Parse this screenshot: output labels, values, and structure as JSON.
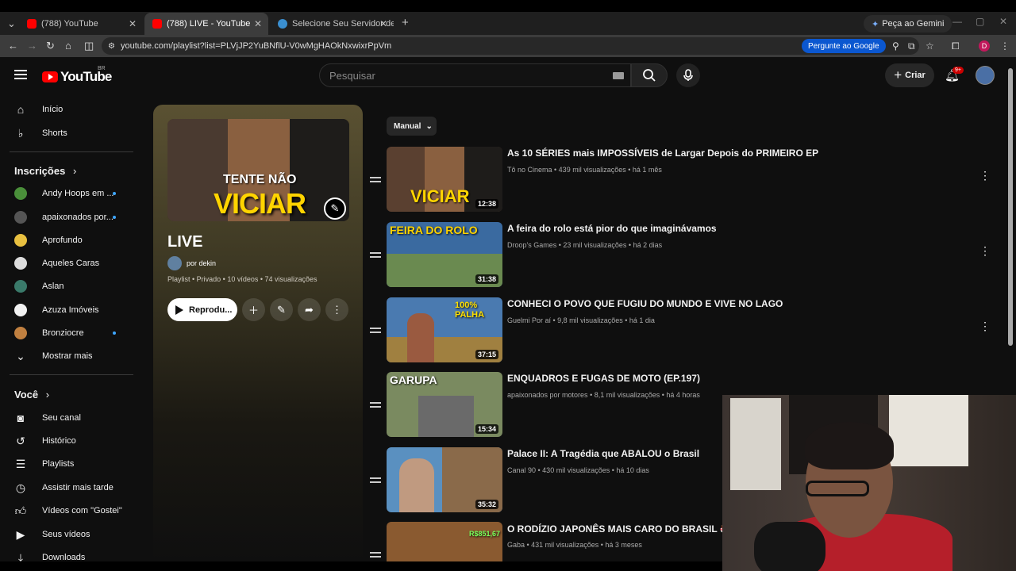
{
  "browser": {
    "tabs": [
      {
        "title": "(788) YouTube",
        "active": false
      },
      {
        "title": "(788) LIVE - YouTube",
        "active": true
      },
      {
        "title": "Selecione Seu Servidor de Jogo",
        "active": false
      }
    ],
    "gemini_label": "Peça ao Gemini",
    "url": "youtube.com/playlist?list=PLVjJP2YuBNflU-V0wMgHAOkNxwixrPpVm",
    "ask_google_label": "Pergunte ao Google",
    "profile_letter": "D"
  },
  "masthead": {
    "logo_text": "YouTube",
    "country": "BR",
    "search_placeholder": "Pesquisar",
    "create_label": "Criar",
    "notifications_badge": "9+"
  },
  "sidebar": {
    "main": [
      {
        "label": "Início",
        "icon": "home-icon"
      },
      {
        "label": "Shorts",
        "icon": "shorts-icon"
      }
    ],
    "subscriptions_heading": "Inscrições",
    "subscriptions": [
      {
        "label": "Andy Hoops em ...",
        "dot": true,
        "color": "#4a8f3a"
      },
      {
        "label": "apaixonados por...",
        "dot": true,
        "color": "#555555"
      },
      {
        "label": "Aprofundo",
        "dot": false,
        "color": "#e8c040"
      },
      {
        "label": "Aqueles Caras",
        "dot": false,
        "color": "#dddddd"
      },
      {
        "label": "Aslan",
        "dot": false,
        "color": "#3a7a6a"
      },
      {
        "label": "Azuza Imóveis",
        "dot": false,
        "color": "#f1f1f1"
      },
      {
        "label": "Bronziocre",
        "dot": true,
        "color": "#c08040"
      }
    ],
    "show_more_label": "Mostrar mais",
    "you_heading": "Você",
    "you_items": [
      {
        "label": "Seu canal",
        "icon": "channel-icon"
      },
      {
        "label": "Histórico",
        "icon": "history-icon"
      },
      {
        "label": "Playlists",
        "icon": "playlists-icon"
      },
      {
        "label": "Assistir mais tarde",
        "icon": "watch-later-icon"
      },
      {
        "label": "Vídeos com \"Gostei\"",
        "icon": "like-icon"
      },
      {
        "label": "Seus vídeos",
        "icon": "your-videos-icon"
      },
      {
        "label": "Downloads",
        "icon": "download-icon"
      }
    ]
  },
  "playlist": {
    "thumb_caption_top": "TENTE NÃO",
    "thumb_caption_big": "VICIAR",
    "title": "LIVE",
    "owner": "por dekin",
    "meta": "Playlist • Privado • 10 vídeos • 74 visualizações",
    "play_label": "Reprodu..."
  },
  "list": {
    "sort_label": "Manual",
    "videos": [
      {
        "title": "As 10 SÉRIES mais IMPOSSÍVEIS de Largar Depois do PRIMEIRO EP",
        "meta": "Tô no Cinema • 439 mil visualizações • há 1 mês",
        "duration": "12:38",
        "thumb_text": "VICIAR",
        "bg": "#5a4030"
      },
      {
        "title": "A feira do rolo está pior do que imaginávamos",
        "meta": "Droop's Games • 23 mil visualizações • há 2 dias",
        "duration": "31:38",
        "thumb_text": "FEIRA DO ROLO",
        "bg": "#3a6aa0"
      },
      {
        "title": "CONHECI O POVO QUE FUGIU DO MUNDO E VIVE NO LAGO",
        "meta": "Guelmi Por aí • 9,8 mil visualizações • há 1 dia",
        "duration": "37:15",
        "thumb_text": "100% PALHA",
        "bg": "#4a7ab0"
      },
      {
        "title": "ENQUADROS E FUGAS DE MOTO (EP.197)",
        "meta": "apaixonados por motores • 8,1 mil visualizações • há 4 horas",
        "duration": "15:34",
        "thumb_text": "GARUPA",
        "bg": "#7a8a60"
      },
      {
        "title": "Palace II: A Tragédia que ABALOU o Brasil",
        "meta": "Canal 90 • 430 mil visualizações • há 10 dias",
        "duration": "35:32",
        "thumb_text": "",
        "bg": "#5a90c0"
      },
      {
        "title": "O RODÍZIO JAPONÊS MAIS CARO DO BRASIL 🍣 💸",
        "meta": "Gaba • 431 mil visualizações • há 3 meses",
        "duration": "",
        "thumb_text": "R$851,67",
        "bg": "#8a5a30"
      }
    ]
  }
}
